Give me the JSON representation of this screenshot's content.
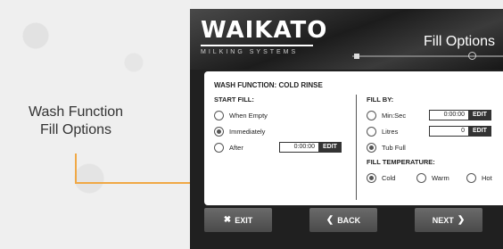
{
  "left_caption": {
    "line1": "Wash Function",
    "line2": "Fill Options"
  },
  "header": {
    "logo_text": "WAIKATO",
    "logo_subtext": "MILKING SYSTEMS",
    "screen_title": "Fill Options"
  },
  "panel": {
    "title": "WASH FUNCTION: COLD RINSE",
    "start_fill": {
      "label": "START FILL:",
      "options": [
        {
          "label": "When Empty",
          "selected": false
        },
        {
          "label": "Immediately",
          "selected": true
        },
        {
          "label": "After",
          "selected": false
        }
      ],
      "after_value": "0:00:00",
      "edit_label": "EDIT"
    },
    "fill_by": {
      "label": "FILL BY:",
      "options": [
        {
          "label": "Min:Sec",
          "selected": false
        },
        {
          "label": "Litres",
          "selected": false
        },
        {
          "label": "Tub Full",
          "selected": true
        }
      ],
      "minsec_value": "0:00:00",
      "litres_value": "0",
      "edit_label": "EDIT"
    },
    "fill_temperature": {
      "label": "FILL TEMPERATURE:",
      "options": [
        {
          "label": "Cold",
          "selected": true
        },
        {
          "label": "Warm",
          "selected": false
        },
        {
          "label": "Hot",
          "selected": false
        }
      ]
    }
  },
  "footer": {
    "exit_label": "EXIT",
    "back_label": "BACK",
    "next_label": "NEXT",
    "exit_icon": "x-icon",
    "back_icon": "chevron-left-icon",
    "next_icon": "chevron-right-icon"
  },
  "colors": {
    "accent_connector": "#f0a845",
    "button": "#555555",
    "header": "#1c1c1c"
  }
}
